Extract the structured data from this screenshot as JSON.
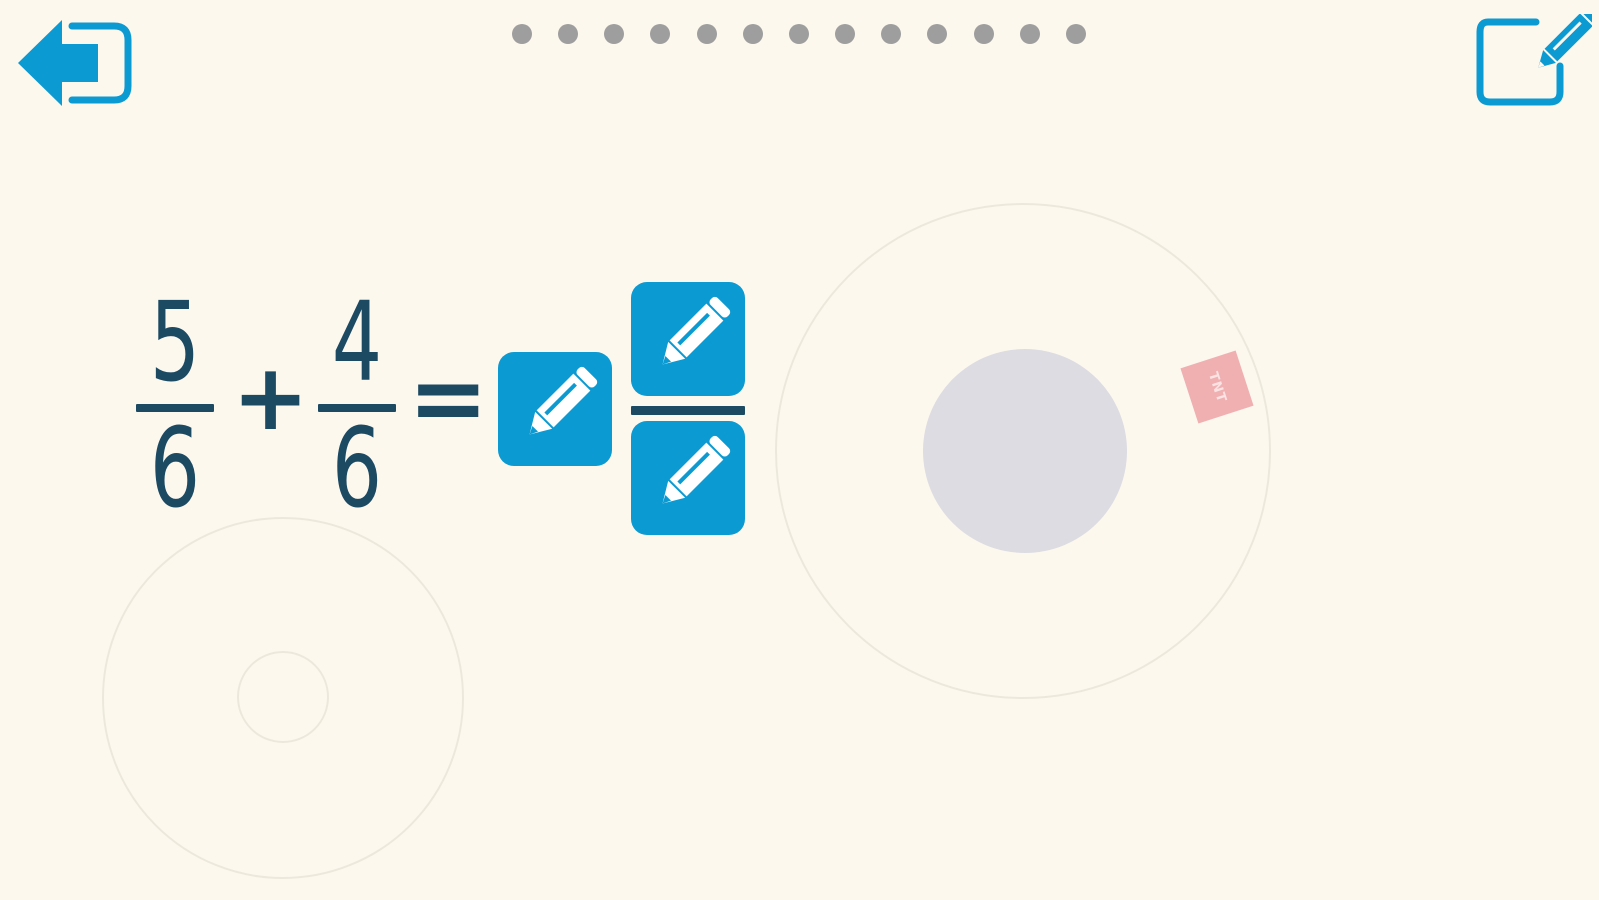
{
  "header": {
    "exit_icon": "exit-arrow-icon",
    "edit_icon": "edit-note-icon",
    "progress": {
      "total_steps": 13
    }
  },
  "equation": {
    "term1": {
      "numerator": "5",
      "denominator": "6"
    },
    "operator": "+",
    "term2": {
      "numerator": "4",
      "denominator": "6"
    },
    "equals": "=",
    "answer": {
      "whole_icon": "pencil-icon",
      "numerator_icon": "pencil-icon",
      "denominator_icon": "pencil-icon"
    }
  },
  "decor": {
    "tnt_label": "TNT"
  },
  "colors": {
    "accent": "#0c9ad2",
    "text": "#1c4a63",
    "background": "#fdf8ee",
    "dot": "#9e9e9e",
    "knob": "#dcdce2",
    "tnt": "#f0b0b1"
  }
}
